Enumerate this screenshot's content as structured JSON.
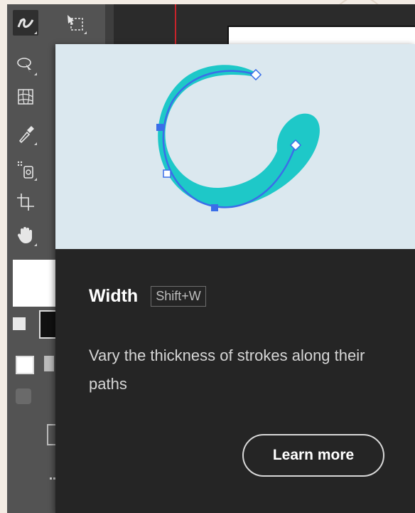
{
  "tooltip": {
    "tool_name": "Width",
    "shortcut": "Shift+W",
    "description": "Vary the thickness of strokes along their paths",
    "learn_more_label": "Learn more"
  },
  "toolbar": {
    "tools": [
      {
        "name": "width-tool-icon",
        "active": true
      },
      {
        "name": "artboard-tool-icon",
        "active": false
      },
      {
        "name": "shaper-tool-icon",
        "active": false
      },
      {
        "name": "mesh-tool-icon",
        "active": false
      },
      {
        "name": "eyedropper-tool-icon",
        "active": false
      },
      {
        "name": "symbol-sprayer-tool-icon",
        "active": false
      },
      {
        "name": "slice-tool-icon",
        "active": false
      },
      {
        "name": "hand-tool-icon",
        "active": false
      }
    ]
  },
  "colors": {
    "accent_teal": "#1ec8c8",
    "path_blue": "#3a6ee8",
    "tooltip_bg": "#252525",
    "preview_bg": "#dbe8ef",
    "toolbar_bg": "#535353"
  }
}
